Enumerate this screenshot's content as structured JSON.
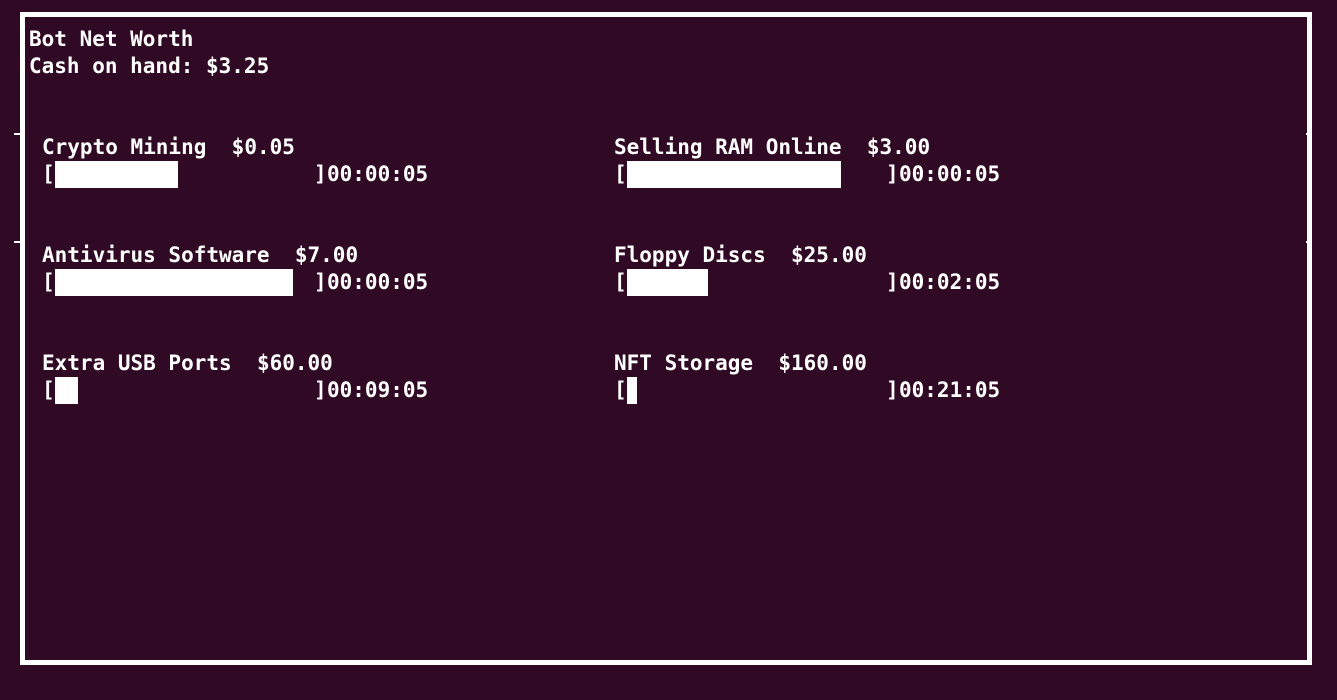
{
  "header": {
    "title": "Bot Net Worth",
    "cash_label": "Cash on hand: $3.25"
  },
  "items": [
    {
      "name": "Crypto Mining",
      "price": "$0.05",
      "progress": 0.47,
      "time": "00:00:05"
    },
    {
      "name": "Selling RAM Online",
      "price": "$3.00",
      "progress": 0.82,
      "time": "00:00:05"
    },
    {
      "name": "Antivirus Software",
      "price": "$7.00",
      "progress": 0.91,
      "time": "00:00:05"
    },
    {
      "name": "Floppy Discs",
      "price": "$25.00",
      "progress": 0.31,
      "time": "00:02:05"
    },
    {
      "name": "Extra USB Ports",
      "price": "$60.00",
      "progress": 0.09,
      "time": "00:09:05"
    },
    {
      "name": "NFT Storage",
      "price": "$160.00",
      "progress": 0.04,
      "time": "00:21:05"
    }
  ],
  "colors": {
    "background": "#300a24",
    "foreground": "#ffffff"
  }
}
